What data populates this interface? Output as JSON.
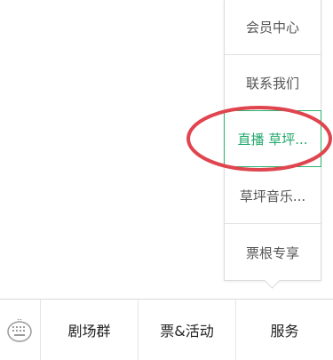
{
  "popup_menu": {
    "items": [
      {
        "label": "会员中心"
      },
      {
        "label": "联系我们"
      },
      {
        "label": "直播 草坪..."
      },
      {
        "label": "草坪音乐..."
      },
      {
        "label": "票根专享"
      }
    ]
  },
  "bottom_nav": {
    "keyboard_icon": "keyboard-icon",
    "tabs": [
      {
        "label": "剧场群"
      },
      {
        "label": "票&活动"
      },
      {
        "label": "服务"
      }
    ]
  },
  "colors": {
    "active_green": "#22a86b",
    "annotation_red": "#e0454f",
    "text_gray": "#555555",
    "text_dark": "#222222"
  }
}
